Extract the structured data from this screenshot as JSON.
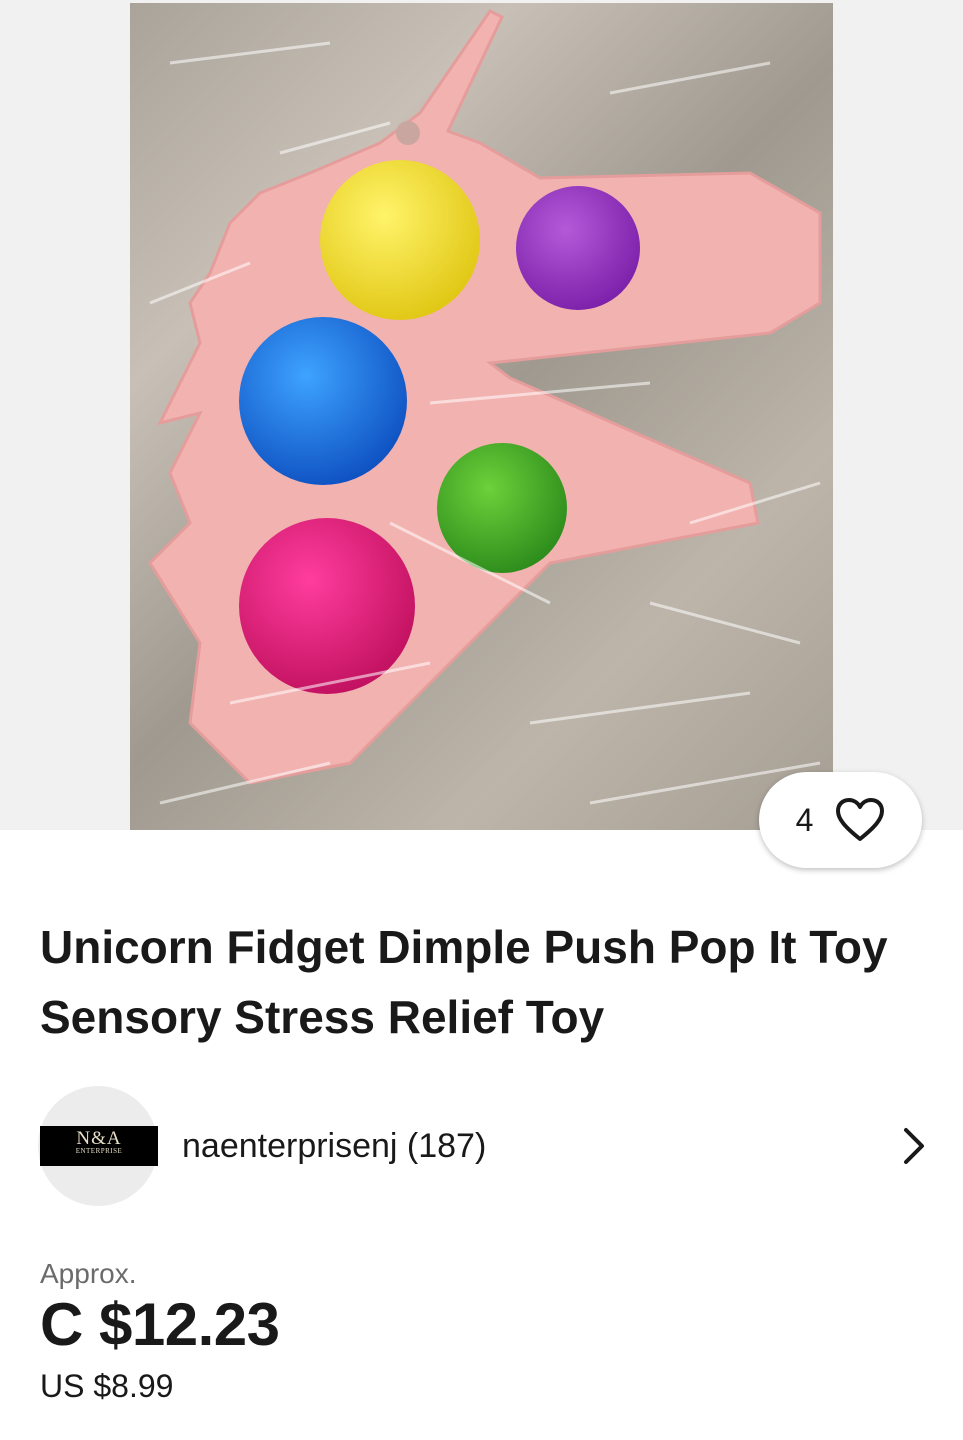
{
  "listing": {
    "watch_count": "4",
    "title": "Unicorn Fidget Dimple Push Pop It Toy Sensory Stress Relief Toy"
  },
  "seller": {
    "logo_text": "N&A",
    "logo_subtext": "ENTERPRISE",
    "name_with_feedback": "naenterprisenj (187)"
  },
  "price": {
    "approx_label": "Approx.",
    "converted": "C $12.23",
    "original": "US $8.99"
  },
  "icons": {
    "watch": "heart-icon",
    "seller_link": "chevron-right-icon"
  },
  "colors": {
    "text_primary": "#191919",
    "text_secondary": "#6b6b6b",
    "toy_body": "#f2b2b0"
  }
}
